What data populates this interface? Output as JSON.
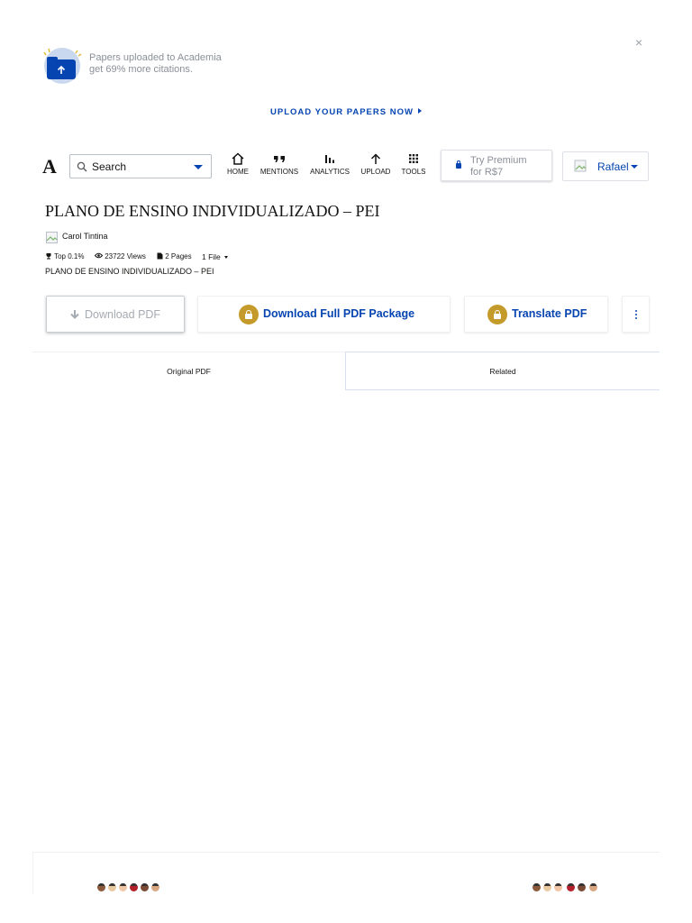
{
  "promo": {
    "text_line1": "Papers uploaded to Academia",
    "text_line2": "get 69% more citations.",
    "cta": "UPLOAD YOUR PAPERS NOW",
    "close_glyph": "×",
    "icon": "upload-folder-illustration"
  },
  "header": {
    "logo": "A",
    "search": {
      "placeholder": "Search"
    },
    "nav": [
      {
        "label": "HOME",
        "icon": "home-icon"
      },
      {
        "label": "MENTIONS",
        "icon": "quote-icon"
      },
      {
        "label": "ANALYTICS",
        "icon": "bar-chart-icon"
      },
      {
        "label": "UPLOAD",
        "icon": "arrow-up-icon"
      },
      {
        "label": "TOOLS",
        "icon": "grid-icon"
      }
    ],
    "premium": {
      "line1": "Try Premium",
      "line2": "for R$7"
    },
    "user": {
      "name": "Rafael"
    }
  },
  "document": {
    "title": "PLANO DE ENSINO INDIVIDUALIZADO – PEI",
    "author": "Carol Tintina",
    "stats": {
      "rank": "Top 0.1%",
      "views": "23722 Views",
      "pages": "2 Pages",
      "files": "1 File"
    },
    "subtitle": "PLANO DE ENSINO INDIVIDUALIZADO – PEI"
  },
  "actions": {
    "download": "Download PDF",
    "package": "Download Full PDF Package",
    "translate": "Translate PDF"
  },
  "tabs": [
    {
      "label": "Original PDF",
      "active": true
    },
    {
      "label": "Related",
      "active": false
    }
  ],
  "colors": {
    "brand_blue": "#0645b1",
    "lock_gold": "#c49a2b",
    "muted_text": "#8a8f98"
  }
}
